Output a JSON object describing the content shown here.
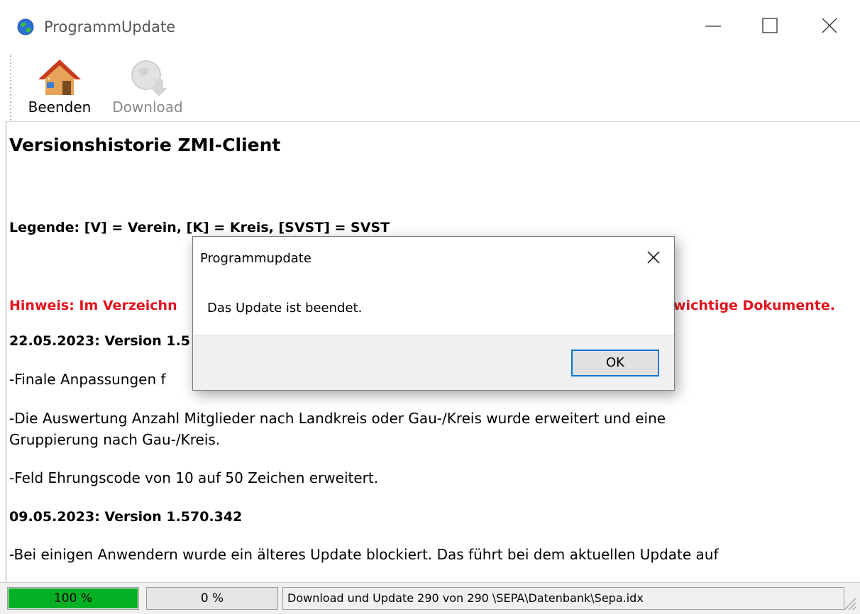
{
  "window": {
    "title": "ProgrammUpdate",
    "icon": "globe-icon"
  },
  "toolbar": {
    "beenden_label": "Beenden",
    "download_label": "Download"
  },
  "content": {
    "heading": "Versionshistorie ZMI-Client",
    "legend": "Legende:  [V] = Verein,  [K] = Kreis,  [SVST] = SVST",
    "notice_left": "Hinweis: Im Verzeichn",
    "notice_right": "wichtige Dokumente.",
    "version1_date": "22.05.2023: Version 1.5",
    "line_finale": "-Finale Anpassungen f",
    "line_auswertung_1": "-Die Auswertung Anzahl Mitglieder nach Landkreis oder Gau-/Kreis wurde erweitert und eine",
    "line_auswertung_2": "Gruppierung nach Gau-/Kreis.",
    "line_feld": "-Feld Ehrungscode von 10 auf 50 Zeichen erweitert.",
    "version2_date": "09.05.2023: Version 1.570.342",
    "line_blockiert_1": "-Bei einigen Anwendern wurde ein älteres Update blockiert. Das führt bei dem aktuellen Update auf"
  },
  "statusbar": {
    "progress1": {
      "text": "100 %",
      "value": 100
    },
    "progress2": {
      "text": "0 %",
      "value": 0
    },
    "message": "Download und Update 290 von 290  \\SEPA\\Datenbank\\Sepa.idx"
  },
  "dialog": {
    "title": "Programmupdate",
    "message": "Das Update ist beendet.",
    "ok_label": "OK"
  },
  "colors": {
    "notice": "#e0141e",
    "progress": "#06b025",
    "focus": "#0078d7"
  }
}
